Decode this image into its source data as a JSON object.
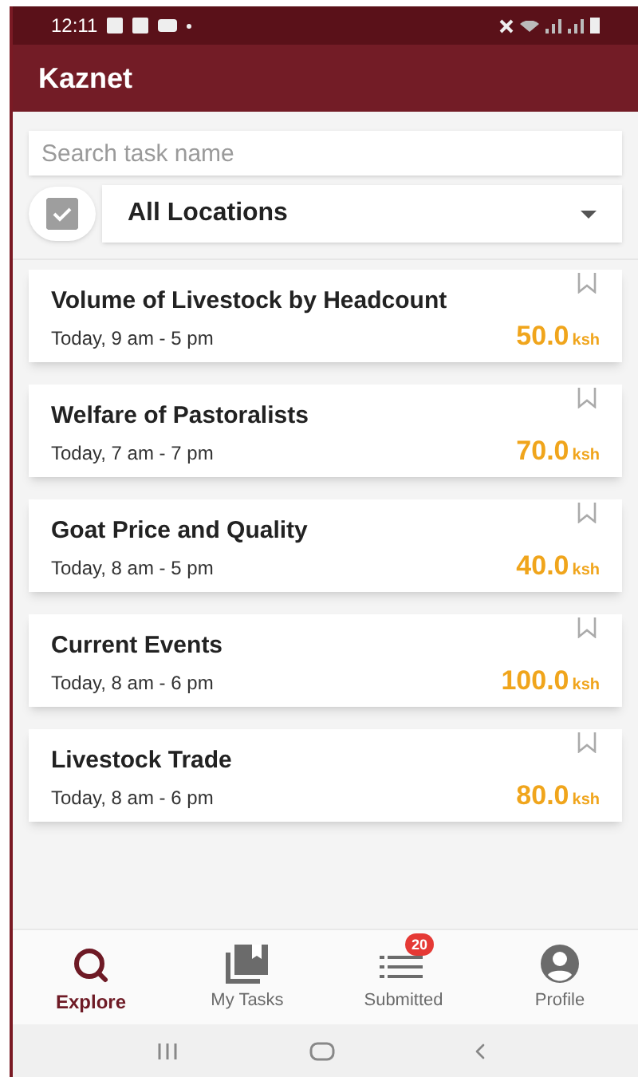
{
  "status_bar": {
    "time": "12:11"
  },
  "app_bar": {
    "title": "Kaznet"
  },
  "search": {
    "placeholder": "Search task name"
  },
  "location_filter": {
    "checked": true,
    "value": "All Locations"
  },
  "tasks": [
    {
      "name": "Volume of Livestock by Headcount",
      "time": "Today, 9 am - 5 pm",
      "amount": "50.0",
      "currency": "ksh"
    },
    {
      "name": "Welfare of Pastoralists",
      "time": "Today, 7 am - 7 pm",
      "amount": "70.0",
      "currency": "ksh"
    },
    {
      "name": "Goat Price and Quality",
      "time": "Today, 8 am - 5 pm",
      "amount": "40.0",
      "currency": "ksh"
    },
    {
      "name": "Current Events",
      "time": "Today, 8 am - 6 pm",
      "amount": "100.0",
      "currency": "ksh"
    },
    {
      "name": "Livestock Trade",
      "time": "Today, 8 am - 6 pm",
      "amount": "80.0",
      "currency": "ksh"
    }
  ],
  "bottom_nav": [
    {
      "kind": "explore",
      "label": "Explore",
      "selected": true
    },
    {
      "kind": "tasks",
      "label": "My Tasks",
      "selected": false
    },
    {
      "kind": "submitted",
      "label": "Submitted",
      "selected": false,
      "badge": "20"
    },
    {
      "kind": "profile",
      "label": "Profile",
      "selected": false
    }
  ]
}
